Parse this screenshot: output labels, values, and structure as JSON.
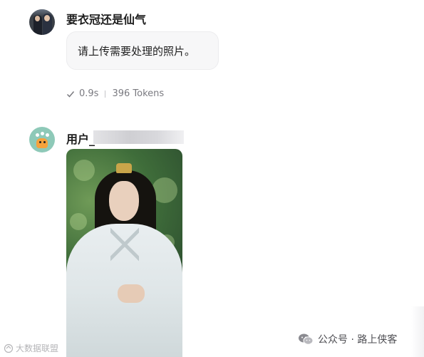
{
  "bot_message": {
    "name": "要衣冠还是仙气",
    "text": "请上传需要处理的照片。",
    "time": "0.9s",
    "tokens": "396 Tokens"
  },
  "user_message": {
    "name": "用户_"
  },
  "watermarks": {
    "left": "大数据联盟",
    "right": "公众号 · 路上侠客"
  }
}
